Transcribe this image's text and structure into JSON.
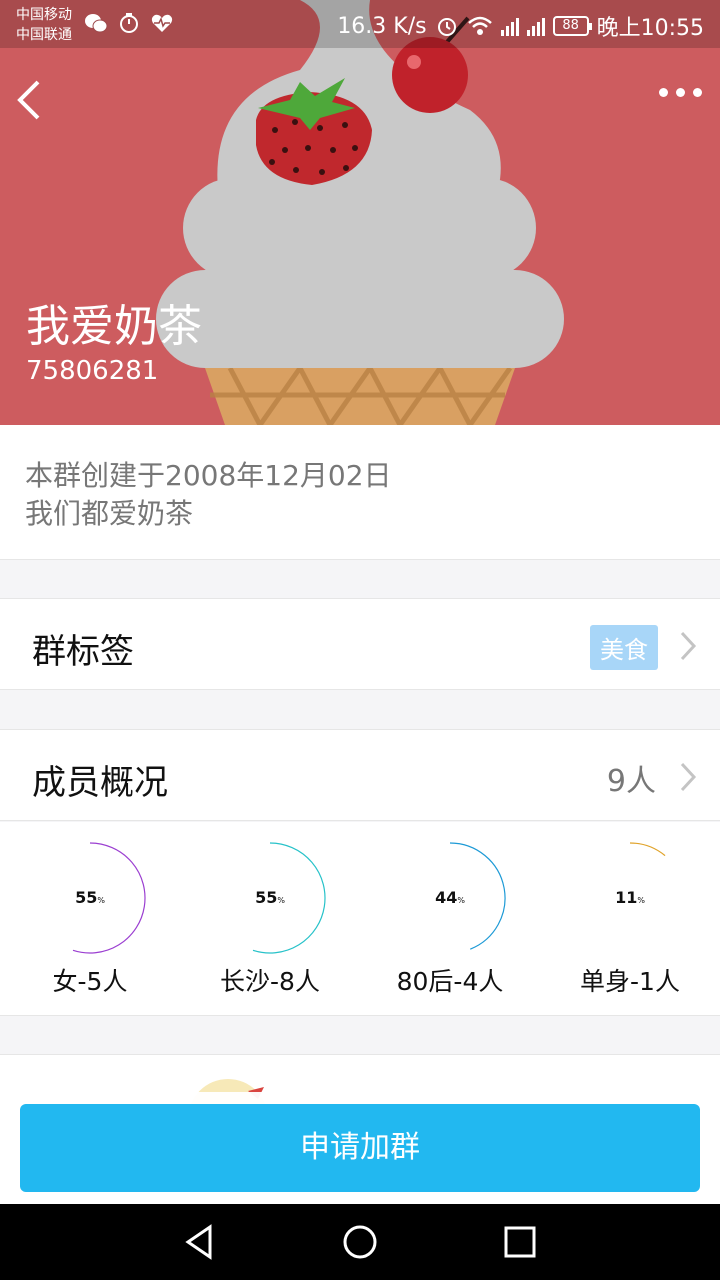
{
  "status_bar": {
    "carrier1": "中国移动",
    "carrier2": "中国联通",
    "speed": "16.3 K/s",
    "net1": "2G",
    "net2": "4G",
    "battery": "88",
    "time": "晚上10:55"
  },
  "group": {
    "name": "我爱奶茶",
    "id": "75806281",
    "created": "本群创建于2008年12月02日",
    "description": "我们都爱奶茶"
  },
  "tags_row": {
    "title": "群标签",
    "tag": "美食"
  },
  "members_row": {
    "title": "成员概况",
    "count": "9人"
  },
  "stats": [
    {
      "pct": "55",
      "unit": "%",
      "label": "女-5人",
      "value": 0.55,
      "color": "#9b3fd1"
    },
    {
      "pct": "55",
      "unit": "%",
      "label": "长沙-8人",
      "value": 0.55,
      "color": "#27c2c9"
    },
    {
      "pct": "44",
      "unit": "%",
      "label": "80后-4人",
      "value": 0.44,
      "color": "#1d9ad6"
    },
    {
      "pct": "11",
      "unit": "%",
      "label": "单身-1人",
      "value": 0.11,
      "color": "#e0a32a"
    }
  ],
  "apply_button": "申请加群",
  "colors": {
    "header_bg": "#cd5c5f",
    "button_bg": "#22b8f0",
    "tag_bg": "#a8d6f8"
  }
}
